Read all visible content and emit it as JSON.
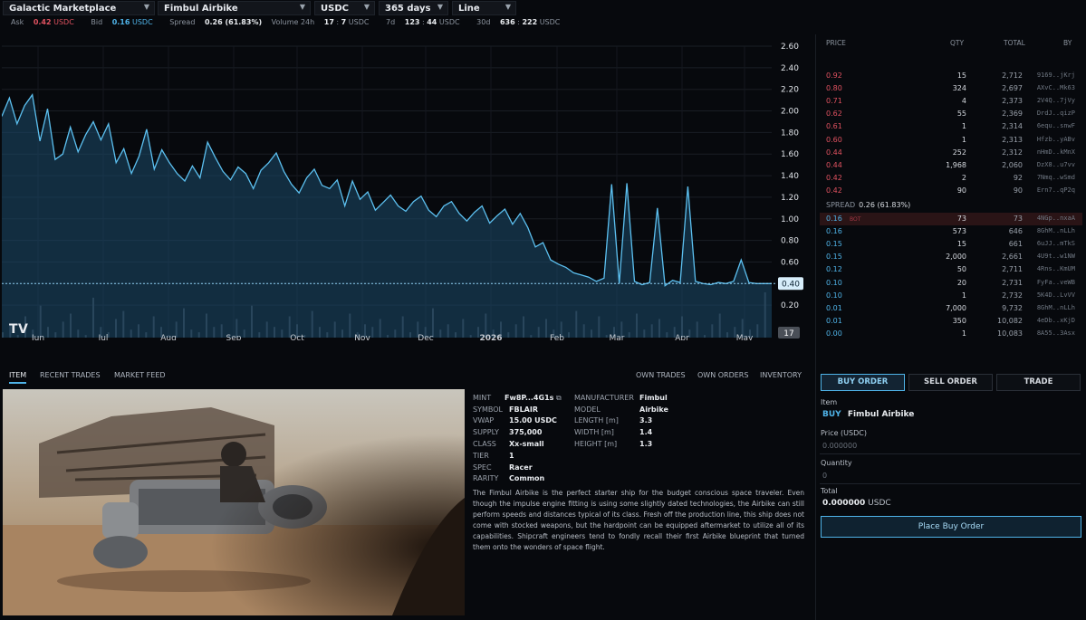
{
  "topbar": {
    "market": "Galactic Marketplace",
    "item": "Fimbul Airbike",
    "currency": "USDC",
    "range": "365 days",
    "chart_type": "Line"
  },
  "stats": {
    "ask_label": "Ask",
    "ask_value": "0.42",
    "ask_unit": "USDC",
    "bid_label": "Bid",
    "bid_value": "0.16",
    "bid_unit": "USDC",
    "spread_label": "Spread",
    "spread_value": "0.26 (61.83%)",
    "vol24_label": "Volume 24h",
    "vol24_a": "17",
    "vol24_b": "7",
    "vol24_unit": "USDC",
    "vol7_label": "7d",
    "vol7_a": "123",
    "vol7_b": "44",
    "vol7_unit": "USDC",
    "vol30_label": "30d",
    "vol30_a": "636",
    "vol30_b": "222",
    "vol30_unit": "USDC"
  },
  "chart_data": {
    "type": "line",
    "ylim": [
      0,
      2.6
    ],
    "y_ticks": [
      "2.60",
      "2.40",
      "2.20",
      "2.00",
      "1.80",
      "1.60",
      "1.40",
      "1.20",
      "1.00",
      "0.80",
      "0.60",
      "0.40",
      "0.20"
    ],
    "x_ticks": [
      "Jun",
      "Jul",
      "Aug",
      "Sep",
      "Oct",
      "Nov",
      "Dec",
      "2026",
      "Feb",
      "Mar",
      "Apr",
      "May"
    ],
    "last_price_label": "0.40",
    "last_price": 0.4,
    "volume_axis_label": "17",
    "colors": {
      "line": "#5cc0f0",
      "fill": "#1c4a6b",
      "volume": "#3b4149"
    },
    "series": [
      {
        "values": [
          1.95,
          2.12,
          1.88,
          2.05,
          2.15,
          1.72,
          2.02,
          1.55,
          1.6,
          1.85,
          1.62,
          1.78,
          1.45,
          1.73,
          1.88,
          1.52,
          1.65,
          1.42,
          1.58,
          1.83,
          1.46,
          1.64,
          1.52,
          1.42,
          1.35,
          1.49,
          1.38,
          1.71,
          1.57,
          1.44,
          1.36,
          1.48,
          1.42,
          1.28,
          1.45,
          1.52,
          1.61,
          1.44,
          1.32,
          1.24,
          1.38,
          1.46,
          1.31,
          1.28,
          1.36,
          1.12,
          1.24,
          1.18,
          1.25,
          1.08,
          1.15,
          1.22,
          1.12,
          1.07,
          1.16,
          1.21,
          1.08,
          1.02,
          1.12,
          1.16,
          1.05,
          0.98,
          1.06,
          1.12,
          0.96,
          1.03,
          1.09,
          0.95,
          0.86,
          0.92,
          0.74,
          0.78,
          0.62,
          0.58,
          0.55,
          0.5,
          0.48,
          0.46,
          0.42,
          0.45,
          0.43,
          0.4,
          0.38,
          0.42,
          0.39,
          0.41,
          0.4,
          0.38,
          0.43,
          0.41,
          0.4,
          0.42,
          0.4,
          0.39,
          0.41,
          0.4,
          0.42,
          0.4,
          0.41,
          0.4,
          0.4,
          0.4
        ]
      }
    ],
    "spikes": [
      {
        "i": 12,
        "v": 1.9
      },
      {
        "i": 46,
        "v": 1.35
      },
      {
        "i": 68,
        "v": 1.05
      },
      {
        "i": 80,
        "v": 1.32
      },
      {
        "i": 82,
        "v": 1.33
      },
      {
        "i": 86,
        "v": 1.1
      },
      {
        "i": 90,
        "v": 1.3
      },
      {
        "i": 97,
        "v": 0.62
      }
    ],
    "volume": [
      2,
      5,
      1,
      8,
      3,
      12,
      4,
      2,
      6,
      9,
      3,
      1,
      15,
      4,
      2,
      7,
      10,
      3,
      5,
      2,
      8,
      4,
      1,
      6,
      11,
      3,
      2,
      9,
      4,
      5,
      1,
      7,
      3,
      12,
      2,
      6,
      4,
      3,
      8,
      5,
      1,
      10,
      4,
      2,
      6,
      3,
      9,
      2,
      5,
      4,
      7,
      1,
      3,
      8,
      2,
      6,
      4,
      11,
      3,
      5,
      2,
      7,
      1,
      4,
      9,
      3,
      6,
      2,
      5,
      8,
      1,
      4,
      7,
      3,
      6,
      2,
      10,
      5,
      3,
      8,
      1,
      4,
      6,
      2,
      9,
      3,
      5,
      7,
      2,
      4,
      8,
      3,
      6,
      1,
      5,
      9,
      2,
      4,
      7,
      3,
      5,
      17
    ]
  },
  "left_tabs": [
    "ITEM",
    "RECENT TRADES",
    "MARKET FEED"
  ],
  "right_tabs": [
    "OWN TRADES",
    "OWN ORDERS",
    "INVENTORY"
  ],
  "item": {
    "mint_label": "MINT",
    "mint": "Fw8P...4G1s",
    "symbol_label": "SYMBOL",
    "symbol": "FBLAIR",
    "vwap_label": "VWAP",
    "vwap": "15.00 USDC",
    "supply_label": "SUPPLY",
    "supply": "375,000",
    "class_label": "CLASS",
    "class": "Xx-small",
    "tier_label": "TIER",
    "tier": "1",
    "spec_label": "SPEC",
    "spec": "Racer",
    "rarity_label": "RARITY",
    "rarity": "Common",
    "manufacturer_label": "MANUFACTURER",
    "manufacturer": "Fimbul",
    "model_label": "MODEL",
    "model": "Airbike",
    "length_label": "LENGTH [m]",
    "length": "3.3",
    "width_label": "WIDTH [m]",
    "width": "1.4",
    "height_label": "HEIGHT [m]",
    "height": "1.3",
    "description": "The Fimbul Airbike is the perfect starter ship for the budget conscious space traveler. Even though the impulse engine fitting is using some slightly dated technologies, the Airbike can still perform speeds and distances typical of its class. Fresh off the production line, this ship does not come with stocked weapons, but the hardpoint can be equipped aftermarket to utilize all of its capabilities. Shipcraft engineers tend to fondly recall their first Airbike blueprint that turned them onto the wonders of space flight."
  },
  "orderbook": {
    "headers": {
      "price": "PRICE",
      "qty": "QTY",
      "total": "TOTAL",
      "by": "BY"
    },
    "asks": [
      {
        "price": "0.92",
        "qty": "15",
        "total": "2,712",
        "by": "9169..jKrj"
      },
      {
        "price": "0.80",
        "qty": "324",
        "total": "2,697",
        "by": "AXvC..Mk63"
      },
      {
        "price": "0.71",
        "qty": "4",
        "total": "2,373",
        "by": "2V4Q..7jVy"
      },
      {
        "price": "0.62",
        "qty": "55",
        "total": "2,369",
        "by": "DrdJ..qizP"
      },
      {
        "price": "0.61",
        "qty": "1",
        "total": "2,314",
        "by": "6equ..snwF"
      },
      {
        "price": "0.60",
        "qty": "1",
        "total": "2,313",
        "by": "Hfzb..yABv"
      },
      {
        "price": "0.44",
        "qty": "252",
        "total": "2,312",
        "by": "nHmD..kMnX"
      },
      {
        "price": "0.44",
        "qty": "1,968",
        "total": "2,060",
        "by": "DzX8..u7vv"
      },
      {
        "price": "0.42",
        "qty": "2",
        "total": "92",
        "by": "7Nmq..wSmd"
      },
      {
        "price": "0.42",
        "qty": "90",
        "total": "90",
        "by": "Ern7..qP2q"
      }
    ],
    "spread_label": "SPREAD",
    "spread_value": "0.26 (61.83%)",
    "bids": [
      {
        "price": "0.16",
        "tag": "BOT",
        "qty": "73",
        "total": "73",
        "by": "4NGp..nxaA"
      },
      {
        "price": "0.16",
        "qty": "573",
        "total": "646",
        "by": "8GhM..nLLh"
      },
      {
        "price": "0.15",
        "qty": "15",
        "total": "661",
        "by": "6uJJ..mTkS"
      },
      {
        "price": "0.15",
        "qty": "2,000",
        "total": "2,661",
        "by": "4U9t..w1NW"
      },
      {
        "price": "0.12",
        "qty": "50",
        "total": "2,711",
        "by": "4Rns..KmUM"
      },
      {
        "price": "0.10",
        "qty": "20",
        "total": "2,731",
        "by": "FyFa..veWB"
      },
      {
        "price": "0.10",
        "qty": "1",
        "total": "2,732",
        "by": "5K4D..LvVV"
      },
      {
        "price": "0.01",
        "qty": "7,000",
        "total": "9,732",
        "by": "8GhM..nLLh"
      },
      {
        "price": "0.01",
        "qty": "350",
        "total": "10,082",
        "by": "4eDb..xKjD"
      },
      {
        "price": "0.00",
        "qty": "1",
        "total": "10,083",
        "by": "8A55..3Asx"
      }
    ]
  },
  "order_form": {
    "buy_tab": "BUY ORDER",
    "sell_tab": "SELL ORDER",
    "trade_tab": "TRADE",
    "item_label": "Item",
    "side": "BUY",
    "item_name": "Fimbul Airbike",
    "price_label": "Price (USDC)",
    "price_placeholder": "0.000000",
    "qty_label": "Quantity",
    "qty_placeholder": "0",
    "total_label": "Total",
    "total_value": "0.000000",
    "total_unit": "USDC",
    "submit": "Place Buy Order"
  }
}
